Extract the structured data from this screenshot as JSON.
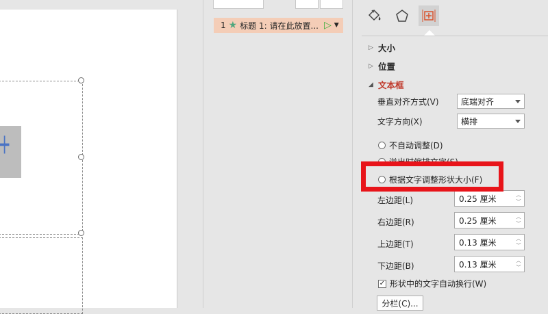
{
  "animation_pane": {
    "item": {
      "number": "1",
      "star_icon": "star-icon",
      "title": "标题 1: 请在此放置...",
      "play_icon": "play-icon",
      "dropdown_icon": "chevron-down-icon"
    }
  },
  "format_pane": {
    "tabs": [
      {
        "icon": "fill-line-icon"
      },
      {
        "icon": "effects-pentagon-icon"
      },
      {
        "icon": "size-properties-icon",
        "active": true
      }
    ],
    "sections": {
      "size": "大小",
      "position": "位置",
      "textbox": "文本框"
    },
    "vertical_align": {
      "label": "垂直对齐方式(V)",
      "value": "底端对齐"
    },
    "text_direction": {
      "label": "文字方向(X)",
      "value": "横排"
    },
    "autofit": {
      "option1": "不自动调整(D)",
      "option2": "溢出时缩排文字(S)",
      "option3": "根据文字调整形状大小(F)"
    },
    "margins": [
      {
        "label": "左边距(L)",
        "value": "0.25 厘米"
      },
      {
        "label": "右边距(R)",
        "value": "0.25 厘米"
      },
      {
        "label": "上边距(T)",
        "value": "0.13 厘米"
      },
      {
        "label": "下边距(B)",
        "value": "0.13 厘米"
      }
    ],
    "wrap_text": {
      "label": "形状中的文字自动换行(W)",
      "checked": true
    },
    "columns_button": "分栏(C)..."
  },
  "colors": {
    "highlight": "#e8141a",
    "section_open": "#c0392b",
    "anim_item_bg": "#f4cdb7"
  }
}
